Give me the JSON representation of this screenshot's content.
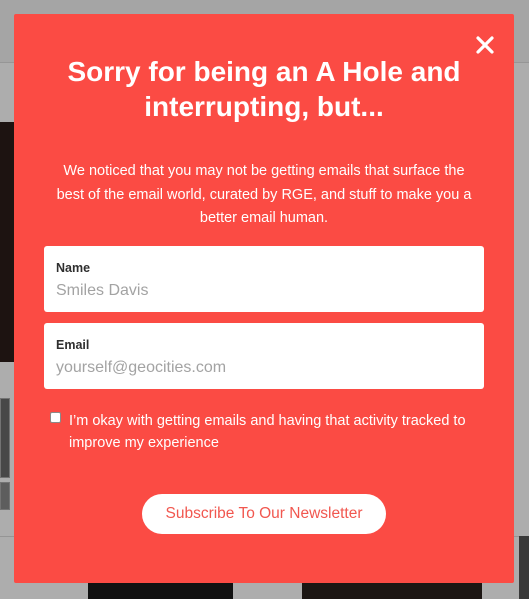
{
  "modal": {
    "title": "Sorry for being an A Hole and interrupting, but...",
    "description": "We noticed that you may not be getting emails that surface the best of the email world, curated by RGE, and stuff to make you a better email human.",
    "close_icon": "close-icon",
    "background_color": "#fb4b44"
  },
  "form": {
    "name_label": "Name",
    "name_placeholder": "Smiles Davis",
    "email_label": "Email",
    "email_placeholder": "yourself@geocities.com",
    "consent_text": "I’m okay with getting emails and having that activity tracked to improve my experience",
    "consent_checked": false,
    "submit_label": "Subscribe To Our Newsletter"
  }
}
